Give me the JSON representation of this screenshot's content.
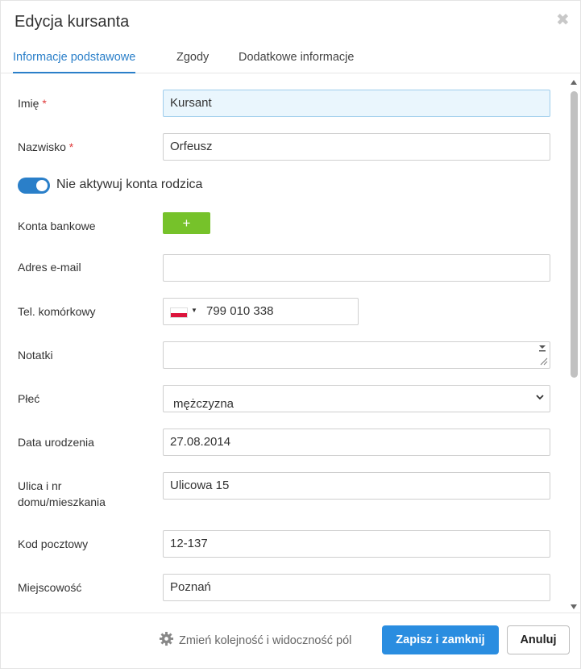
{
  "dialog": {
    "title": "Edycja kursanta",
    "close_symbol": "✖"
  },
  "tabs": [
    {
      "label": "Informacje podstawowe",
      "active": true
    },
    {
      "label": "Zgody",
      "active": false
    },
    {
      "label": "Dodatkowe informacje",
      "active": false
    }
  ],
  "form": {
    "first_name": {
      "label": "Imię",
      "required_mark": "*",
      "value": "Kursant"
    },
    "last_name": {
      "label": "Nazwisko",
      "required_mark": "*",
      "value": "Orfeusz"
    },
    "parent_toggle": {
      "label": "Nie aktywuj konta rodzica",
      "checked": true
    },
    "bank_accounts": {
      "label": "Konta bankowe",
      "add_symbol": "+"
    },
    "email": {
      "label": "Adres e-mail",
      "value": ""
    },
    "mobile": {
      "label": "Tel. komórkowy",
      "country": "PL",
      "caret": "▼",
      "value": "799 010 338"
    },
    "notes": {
      "label": "Notatki",
      "value": ""
    },
    "gender": {
      "label": "Płeć",
      "value": "mężczyzna"
    },
    "birth_date": {
      "label": "Data urodzenia",
      "value": "27.08.2014"
    },
    "street": {
      "label_line1": "Ulica i nr",
      "label_line2": "domu/mieszkania",
      "value": "Ulicowa 15"
    },
    "postal_code": {
      "label": "Kod pocztowy",
      "value": "12-137"
    },
    "city": {
      "label": "Miejscowość",
      "value": "Poznań"
    }
  },
  "footer": {
    "settings_link": "Zmień kolejność i widoczność pól",
    "save_button": "Zapisz i zamknij",
    "cancel_button": "Anuluj"
  },
  "colors": {
    "accent": "#2a7fc9",
    "primary_button": "#2a8de0",
    "add_button": "#76c22a",
    "required": "#e03b3b",
    "focused_input_bg": "#eaf6fd"
  }
}
